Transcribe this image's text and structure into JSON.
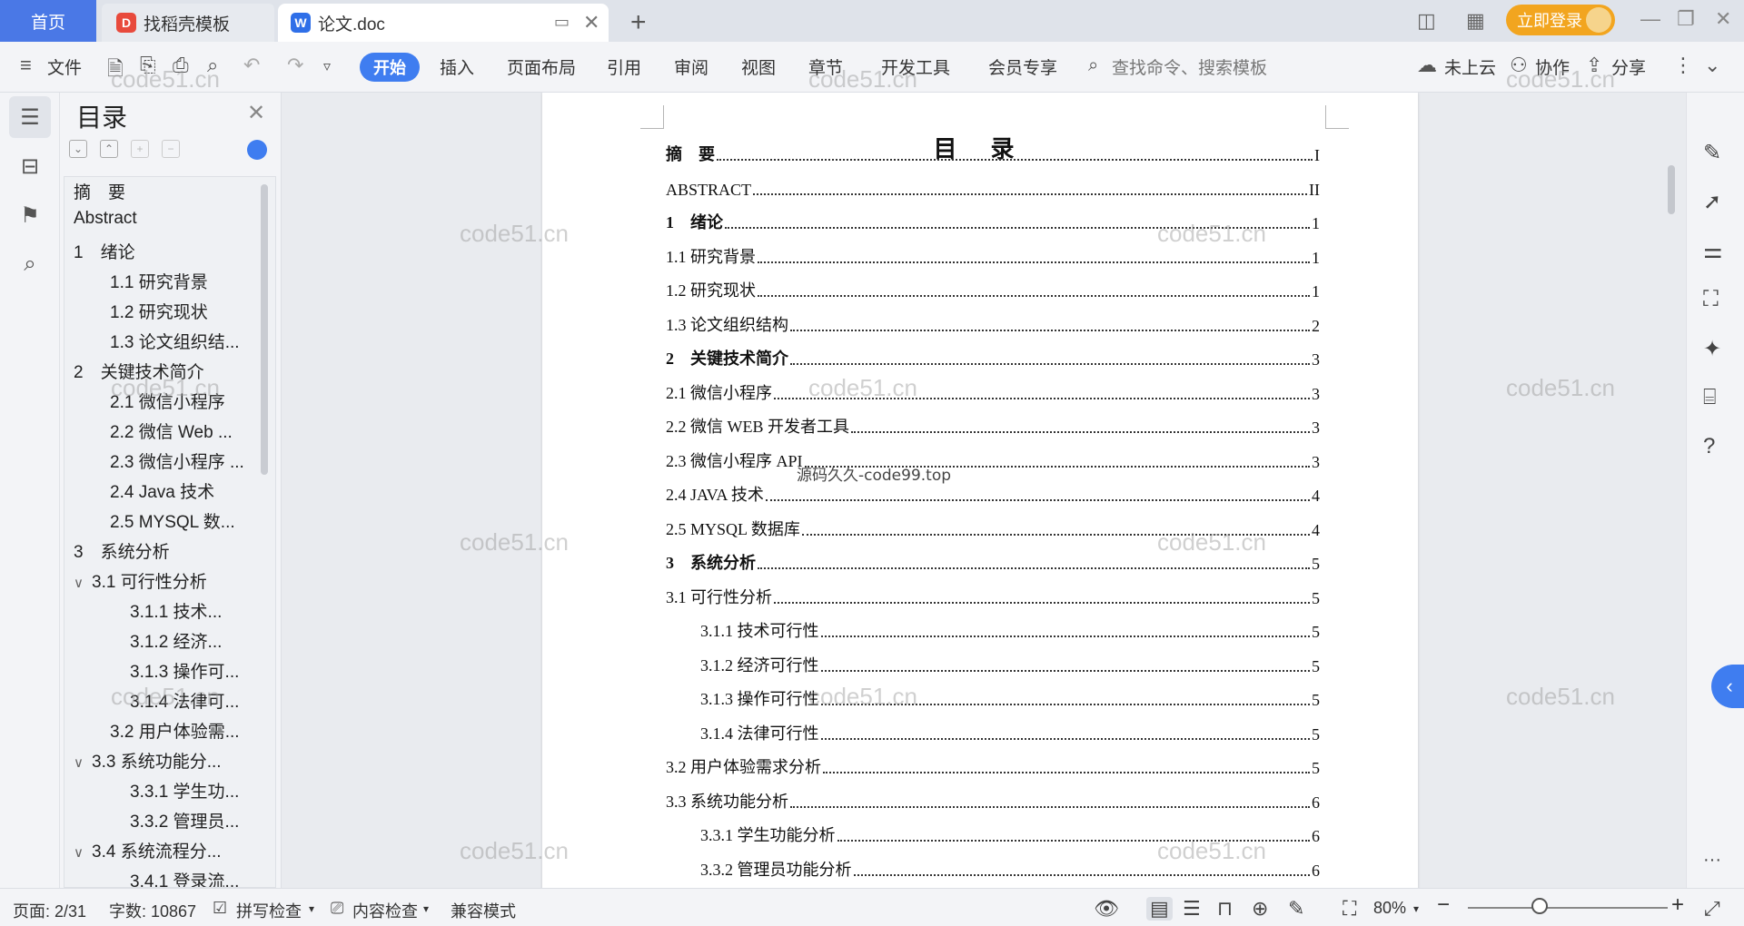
{
  "titlebar": {
    "home_tab": "首页",
    "tabs": [
      {
        "label": "找稻壳模板",
        "logo": "D"
      },
      {
        "label": "论文.doc",
        "logo": "W"
      }
    ],
    "login_label": "立即登录"
  },
  "toolbar": {
    "file_menu": "文件",
    "ribbon_tabs": [
      "开始",
      "插入",
      "页面布局",
      "引用",
      "审阅",
      "视图",
      "章节",
      "开发工具",
      "会员专享"
    ],
    "search_placeholder": "查找命令、搜索模板",
    "cloud_label": "未上云",
    "collab_label": "协作",
    "share_label": "分享"
  },
  "toc_panel": {
    "title": "目录",
    "items": [
      {
        "label": "摘　要",
        "level": 1,
        "chev": ""
      },
      {
        "label": "Abstract",
        "level": 1,
        "chev": ""
      },
      {
        "label": "1　绪论",
        "level": 1,
        "chev": "∨"
      },
      {
        "label": "1.1 研究背景",
        "level": 2,
        "chev": ""
      },
      {
        "label": "1.2 研究现状",
        "level": 2,
        "chev": ""
      },
      {
        "label": "1.3 论文组织结...",
        "level": 2,
        "chev": ""
      },
      {
        "label": "2　关键技术简介",
        "level": 1,
        "chev": "∨"
      },
      {
        "label": "2.1 微信小程序",
        "level": 2,
        "chev": ""
      },
      {
        "label": "2.2 微信 Web ...",
        "level": 2,
        "chev": ""
      },
      {
        "label": "2.3 微信小程序 ...",
        "level": 2,
        "chev": ""
      },
      {
        "label": "2.4 Java 技术",
        "level": 2,
        "chev": ""
      },
      {
        "label": "2.5 MYSQL 数...",
        "level": 2,
        "chev": ""
      },
      {
        "label": "3　系统分析",
        "level": 1,
        "chev": "∨"
      },
      {
        "label": "3.1 可行性分析",
        "level": 2,
        "chev": "∨"
      },
      {
        "label": "3.1.1 技术...",
        "level": 3,
        "chev": ""
      },
      {
        "label": "3.1.2 经济...",
        "level": 3,
        "chev": ""
      },
      {
        "label": "3.1.3 操作可...",
        "level": 3,
        "chev": ""
      },
      {
        "label": "3.1.4 法律可...",
        "level": 3,
        "chev": ""
      },
      {
        "label": "3.2 用户体验需...",
        "level": 2,
        "chev": ""
      },
      {
        "label": "3.3 系统功能分...",
        "level": 2,
        "chev": "∨"
      },
      {
        "label": "3.3.1 学生功...",
        "level": 3,
        "chev": ""
      },
      {
        "label": "3.3.2 管理员...",
        "level": 3,
        "chev": ""
      },
      {
        "label": "3.4 系统流程分...",
        "level": 2,
        "chev": "∨"
      },
      {
        "label": "3.4.1 登录流...",
        "level": 3,
        "chev": ""
      }
    ]
  },
  "document": {
    "title": "目 录",
    "entries": [
      {
        "text": "摘　要",
        "page": "I",
        "bold": true,
        "indent": false
      },
      {
        "text": "ABSTRACT",
        "page": "II",
        "bold": false,
        "indent": false
      },
      {
        "text": "1　绪论",
        "page": "1",
        "bold": true,
        "indent": false
      },
      {
        "text": "1.1 研究背景",
        "page": "1",
        "bold": false,
        "indent": false
      },
      {
        "text": "1.2 研究现状",
        "page": "1",
        "bold": false,
        "indent": false
      },
      {
        "text": "1.3 论文组织结构",
        "page": "2",
        "bold": false,
        "indent": false
      },
      {
        "text": "2　关键技术简介",
        "page": "3",
        "bold": true,
        "indent": false
      },
      {
        "text": "2.1 微信小程序",
        "page": "3",
        "bold": false,
        "indent": false
      },
      {
        "text": "2.2 微信 WEB 开发者工具",
        "page": "3",
        "bold": false,
        "indent": false
      },
      {
        "text": "2.3 微信小程序 API",
        "page": "3",
        "bold": false,
        "indent": false
      },
      {
        "text": "2.4 JAVA 技术",
        "page": "4",
        "bold": false,
        "indent": false
      },
      {
        "text": "2.5 MYSQL 数据库",
        "page": "4",
        "bold": false,
        "indent": false
      },
      {
        "text": "3　系统分析",
        "page": "5",
        "bold": true,
        "indent": false
      },
      {
        "text": "3.1 可行性分析",
        "page": "5",
        "bold": false,
        "indent": false
      },
      {
        "text": "3.1.1  技术可行性",
        "page": "5",
        "bold": false,
        "indent": true
      },
      {
        "text": "3.1.2  经济可行性",
        "page": "5",
        "bold": false,
        "indent": true
      },
      {
        "text": "3.1.3 操作可行性",
        "page": "5",
        "bold": false,
        "indent": true
      },
      {
        "text": "3.1.4 法律可行性",
        "page": "5",
        "bold": false,
        "indent": true
      },
      {
        "text": "3.2 用户体验需求分析",
        "page": "5",
        "bold": false,
        "indent": false
      },
      {
        "text": "3.3 系统功能分析",
        "page": "6",
        "bold": false,
        "indent": false
      },
      {
        "text": "3.3.1 学生功能分析",
        "page": "6",
        "bold": false,
        "indent": true
      },
      {
        "text": "3.3.2 管理员功能分析",
        "page": "6",
        "bold": false,
        "indent": true
      }
    ],
    "overlay_text": "源码久久-code99.top",
    "watermark": "code51.cn"
  },
  "statusbar": {
    "page_info": "页面: 2/31",
    "word_count": "字数: 10867",
    "spell_check": "拼写检查",
    "content_check": "内容检查",
    "compat_mode": "兼容模式",
    "zoom": "80%"
  },
  "icons": {
    "accent": "#3f7df0",
    "login_bg": "#f2a51f",
    "home_tab_bg": "#4a78e6"
  }
}
